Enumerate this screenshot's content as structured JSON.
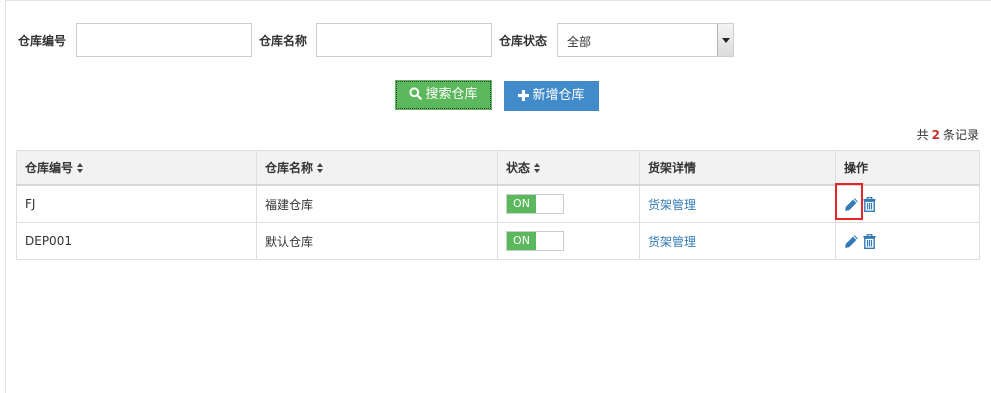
{
  "filters": {
    "code_label": "仓库编号",
    "code_value": "",
    "name_label": "仓库名称",
    "name_value": "",
    "status_label": "仓库状态",
    "status_selected": "全部"
  },
  "buttons": {
    "search_label": "搜索仓库",
    "add_label": "新增仓库"
  },
  "summary": {
    "prefix": "共",
    "count": "2",
    "suffix": "条记录"
  },
  "table": {
    "headers": [
      "仓库编号",
      "仓库名称",
      "状态",
      "货架详情",
      "操作"
    ],
    "rows": [
      {
        "code": "FJ",
        "name": "福建仓库",
        "status": "ON",
        "shelf": "货架管理"
      },
      {
        "code": "DEP001",
        "name": "默认仓库",
        "status": "ON",
        "shelf": "货架管理"
      }
    ]
  },
  "colors": {
    "success": "#5cb85c",
    "primary": "#428bca",
    "link": "#337ab7",
    "highlight": "#e8242b"
  }
}
